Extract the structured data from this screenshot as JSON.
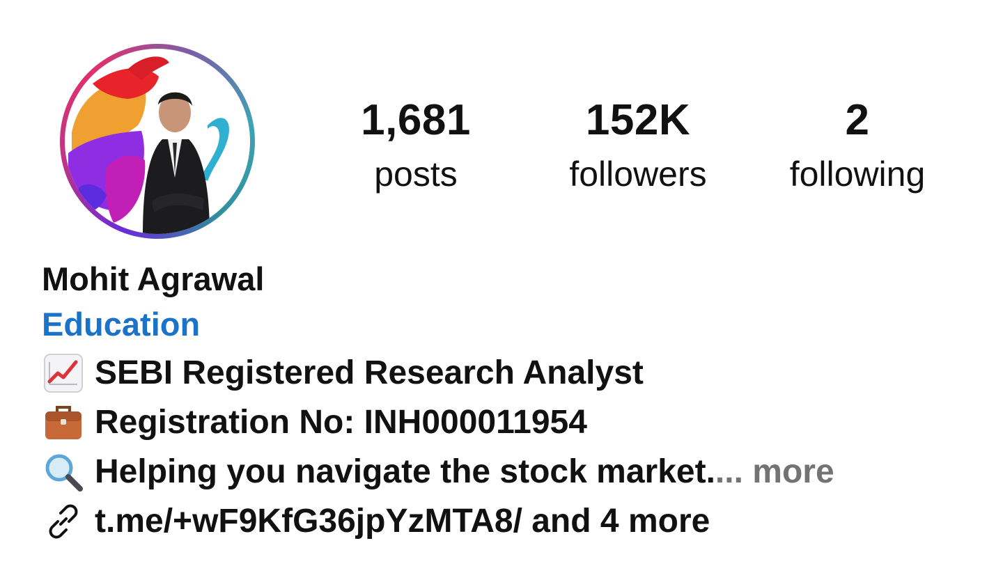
{
  "profile": {
    "stats": [
      {
        "value": "1,681",
        "label": "posts"
      },
      {
        "value": "152K",
        "label": "followers"
      },
      {
        "value": "2",
        "label": "following"
      }
    ],
    "name": "Mohit Agrawal",
    "category": "Education",
    "bio": [
      {
        "icon": "chart-increasing-icon",
        "text": "SEBI Registered Research Analyst"
      },
      {
        "icon": "briefcase-icon",
        "text": "Registration No: INH000011954"
      },
      {
        "icon": "magnifying-glass-icon",
        "text": "Helping you navigate the stock market.",
        "ellipsis": "...",
        "more": " more"
      }
    ],
    "link": {
      "icon": "link-icon",
      "text": "t.me/+wF9KfG36jpYzMTA8/ and 4 more"
    }
  },
  "colors": {
    "category": "#1a73c8",
    "more": "#737373",
    "text": "#111111"
  }
}
